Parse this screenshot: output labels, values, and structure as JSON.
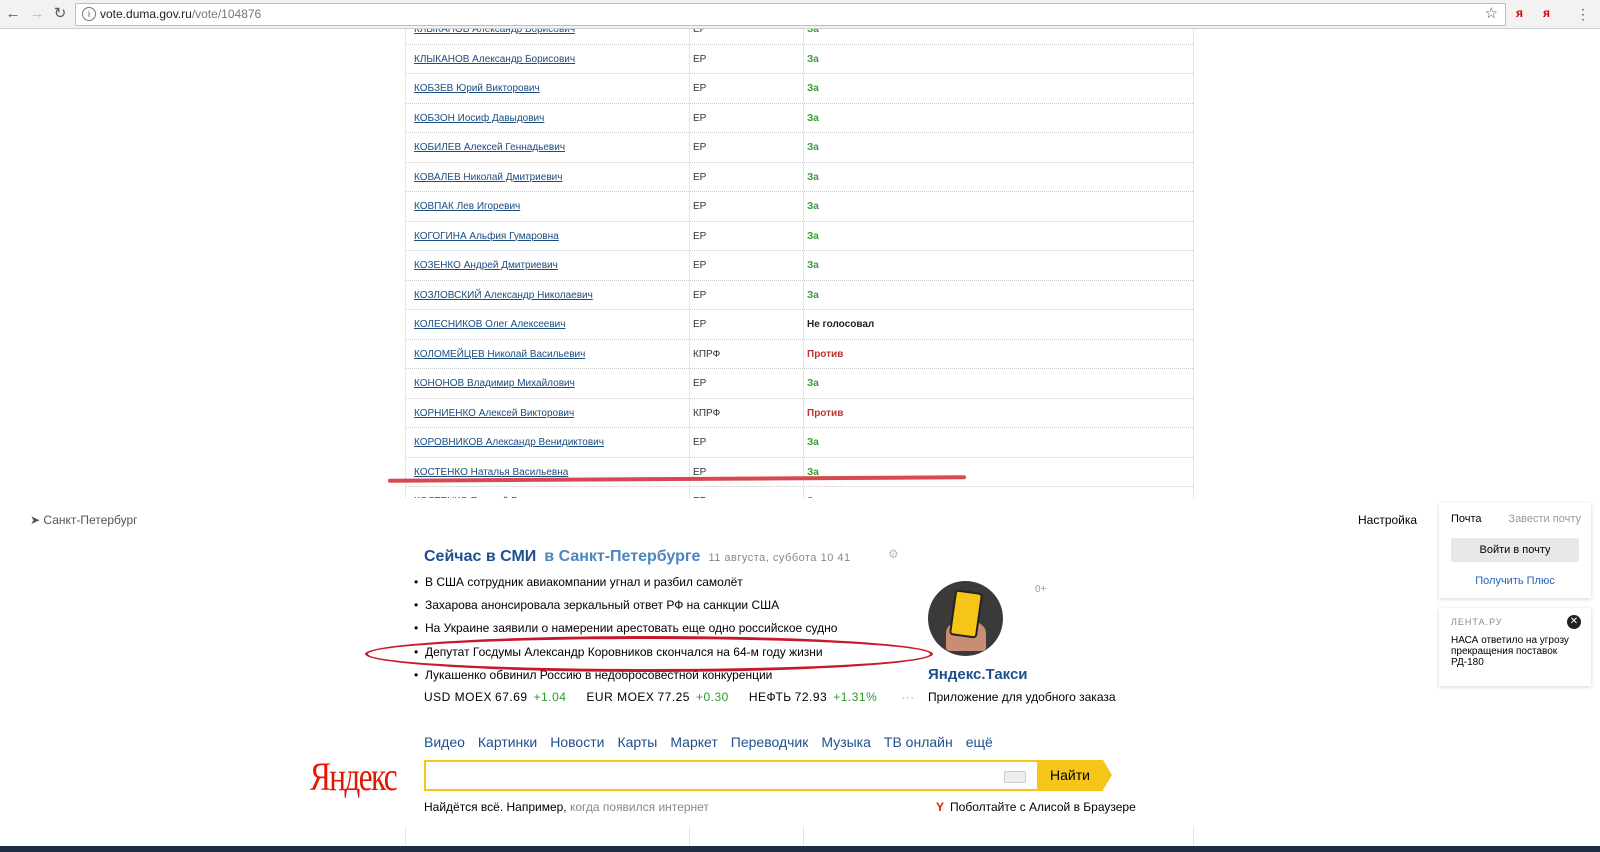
{
  "browser": {
    "url_host": "vote.duma.gov.ru",
    "url_path": "/vote/104876",
    "ext1": "я",
    "ext2": "я"
  },
  "vote_table": {
    "rows": [
      {
        "name": "КЛЫКАНОВ Александр Борисович",
        "party": "ЕР",
        "vote": "За",
        "kind": "za"
      },
      {
        "name": "КЛЫКАНОВ Александр Борисович",
        "party": "ЕР",
        "vote": "За",
        "kind": "za"
      },
      {
        "name": "КОБЗЕВ Юрий Викторович",
        "party": "ЕР",
        "vote": "За",
        "kind": "za"
      },
      {
        "name": "КОБЗОН Иосиф Давыдович",
        "party": "ЕР",
        "vote": "За",
        "kind": "za"
      },
      {
        "name": "КОБИЛЕВ Алексей Геннадьевич",
        "party": "ЕР",
        "vote": "За",
        "kind": "za"
      },
      {
        "name": "КОВАЛЕВ Николай Дмитриевич",
        "party": "ЕР",
        "vote": "За",
        "kind": "za"
      },
      {
        "name": "КОВПАК Лев Игоревич",
        "party": "ЕР",
        "vote": "За",
        "kind": "za"
      },
      {
        "name": "КОГОГИНА Альфия Гумаровна",
        "party": "ЕР",
        "vote": "За",
        "kind": "za"
      },
      {
        "name": "КОЗЕНКО Андрей Дмитриевич",
        "party": "ЕР",
        "vote": "За",
        "kind": "za"
      },
      {
        "name": "КОЗЛОВСКИЙ Александр Николаевич",
        "party": "ЕР",
        "vote": "За",
        "kind": "za"
      },
      {
        "name": "КОЛЕСНИКОВ Олег Алексеевич",
        "party": "ЕР",
        "vote": "Не голосовал",
        "kind": "none"
      },
      {
        "name": "КОЛОМЕЙЦЕВ Николай Васильевич",
        "party": "КПРФ",
        "vote": "Против",
        "kind": "protiv"
      },
      {
        "name": "КОНОНОВ Владимир Михайлович",
        "party": "ЕР",
        "vote": "За",
        "kind": "za"
      },
      {
        "name": "КОРНИЕНКО Алексей Викторович",
        "party": "КПРФ",
        "vote": "Против",
        "kind": "protiv"
      },
      {
        "name": "КОРОВНИКОВ Александр Венидиктович",
        "party": "ЕР",
        "vote": "За",
        "kind": "za"
      },
      {
        "name": "КОСТЕНКО Наталья Васильевна",
        "party": "ЕР",
        "vote": "За",
        "kind": "za"
      },
      {
        "name": "КОСТЕНКО Евгений Викторович",
        "party": "ЕР",
        "vote": "За",
        "kind": "za"
      }
    ]
  },
  "yandex": {
    "city": "Санкт-Петербург",
    "settings": "Настройка",
    "mail": {
      "title": "Почта",
      "create": "Завести почту",
      "login": "Войти в почту",
      "plus": "Получить Плюс"
    },
    "lenta": {
      "source": "ЛЕНТА.РУ",
      "close": "✕",
      "text": "НАСА ответило на угрозу прекращения поставок РД-180"
    },
    "news": {
      "title": "Сейчас в СМИ",
      "region": "в Санкт-Петербурге",
      "date": "11 августа, суббота 10 41",
      "items": [
        "В США сотрудник авиакомпании угнал и разбил самолёт",
        "Захарова анонсировала зеркальный ответ РФ на санкции США",
        "На Украине заявили о намерении арестовать еще одно российское судно",
        "Депутат Госдумы Александр Коровников скончался на 64-м году жизни",
        "Лукашенко обвинил Россию в недобросовестной конкуренции"
      ]
    },
    "rates": [
      {
        "name": "USD MOEX",
        "value": "67.69",
        "change": "+1.04"
      },
      {
        "name": "EUR MOEX",
        "value": "77.25",
        "change": "+0.30"
      },
      {
        "name": "НЕФТЬ",
        "value": "72.93",
        "change": "+1.31%"
      }
    ],
    "rates_more": "···",
    "taxi": {
      "age": "0+",
      "title": "Яндекс.Такси",
      "subtitle": "Приложение для удобного заказа"
    },
    "services": [
      "Видео",
      "Картинки",
      "Новости",
      "Карты",
      "Маркет",
      "Переводчик",
      "Музыка",
      "ТВ онлайн",
      "ещё"
    ],
    "logo": "Яндекс",
    "search_button": "Найти",
    "hint_prefix": "Найдётся всё. Например,",
    "hint_example": "когда появился интернет",
    "alice_icon": "Y",
    "alice": "Поболтайте с Алисой в Браузере"
  },
  "colors": {
    "accent_yellow": "#f5c518",
    "yandex_red": "#e61400",
    "annotation_red": "#c8182a",
    "vote_for": "#3c9a3c",
    "vote_against": "#b33333"
  }
}
